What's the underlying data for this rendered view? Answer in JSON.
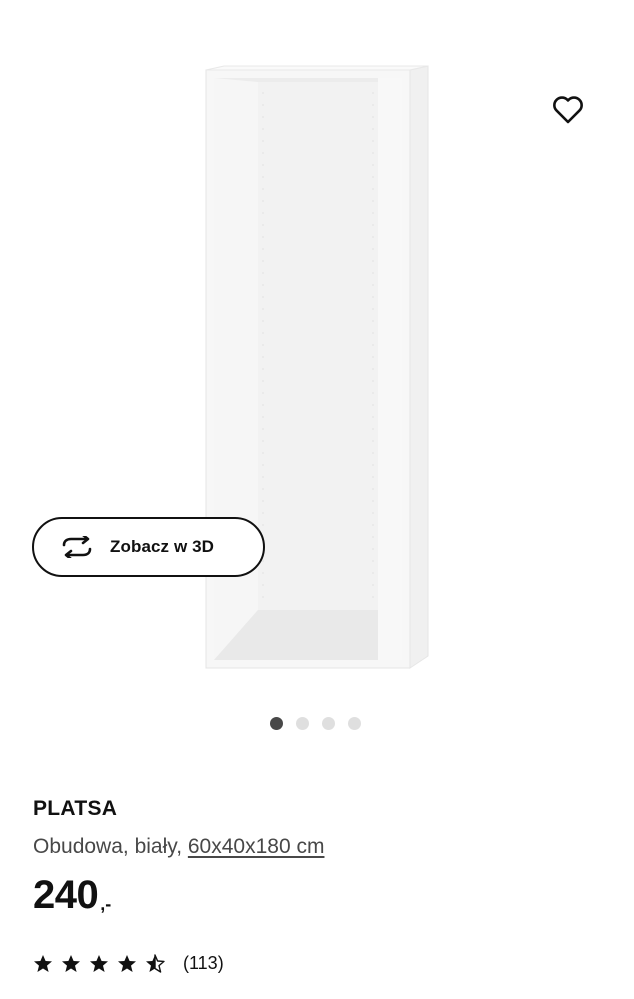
{
  "gallery": {
    "image_alt": "PLATSA frame",
    "wishlist_icon": "heart-icon",
    "view3d": {
      "icon": "rotate-3d-icon",
      "label": "Zobacz w 3D"
    },
    "slides": 4,
    "active_slide": 1
  },
  "product": {
    "name": "PLATSA",
    "description": "Obudowa, biały,",
    "dimensions": "60x40x180 cm",
    "price": {
      "integer": "240",
      "suffix": ",-"
    },
    "rating": {
      "stars": 4.5,
      "max_stars": 5,
      "count": "(113)"
    }
  },
  "colors": {
    "text": "#111111",
    "secondary_text": "#484848",
    "dot_active": "#484848",
    "dot_inactive": "#dfdfdf"
  }
}
